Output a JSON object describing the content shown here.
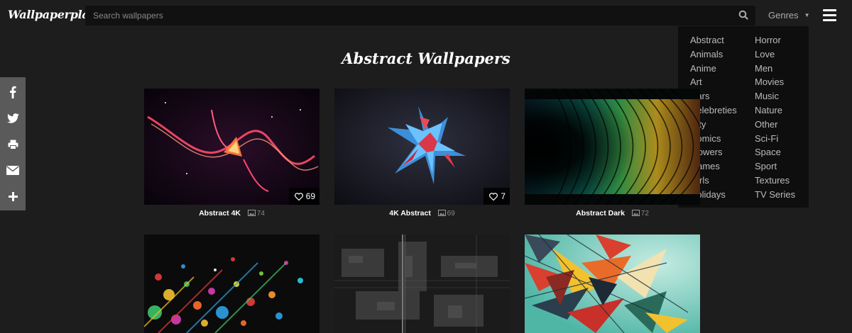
{
  "header": {
    "logo": "Wallpaperplay",
    "search_placeholder": "Search wallpapers",
    "genres_label": "Genres",
    "menu_icon": "hamburger-menu-icon"
  },
  "genres": {
    "column1": [
      "Abstract",
      "Animals",
      "Anime",
      "Art",
      "Cars",
      "Celebreties",
      "City",
      "Comics",
      "Flowers",
      "Games",
      "Girls",
      "Holidays"
    ],
    "column2": [
      "Horror",
      "Love",
      "Men",
      "Movies",
      "Music",
      "Nature",
      "Other",
      "Sci-Fi",
      "Space",
      "Sport",
      "Textures",
      "TV Series"
    ]
  },
  "share": {
    "items": [
      "facebook-icon",
      "twitter-icon",
      "print-icon",
      "email-icon",
      "plus-icon"
    ]
  },
  "page": {
    "title": "Abstract Wallpapers"
  },
  "wallpapers": [
    {
      "name": "Abstract 4K",
      "likes": "69",
      "count": "74"
    },
    {
      "name": "4K Abstract",
      "likes": "7",
      "count": "69"
    },
    {
      "name": "Abstract Dark",
      "likes": "",
      "count": "72"
    },
    {
      "name": "",
      "likes": "",
      "count": ""
    },
    {
      "name": "",
      "likes": "",
      "count": ""
    },
    {
      "name": "",
      "likes": "",
      "count": ""
    }
  ],
  "colors": {
    "background": "#1d1d1d",
    "search_bg": "#111111",
    "dropdown_bg": "#0e0e0e",
    "share_bg": "#5a5a5a"
  }
}
